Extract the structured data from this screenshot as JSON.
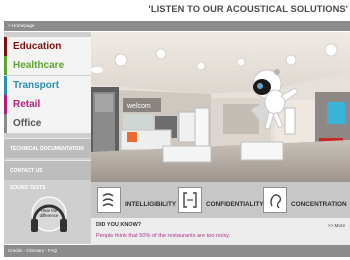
{
  "header": {
    "slogan": "'LISTEN TO OUR ACOUSTICAL SOLUTIONS'",
    "breadcrumb": "> Homepage"
  },
  "sidebar": {
    "nav_items": [
      {
        "label": "Education",
        "color": "#7a1111"
      },
      {
        "label": "Healthcare",
        "color": "#5ea531"
      },
      {
        "label": "Transport",
        "color": "#2a8fb6"
      },
      {
        "label": "Retail",
        "color": "#b41d7c"
      },
      {
        "label": "Office",
        "color": "#565656"
      }
    ],
    "technical_documentation": "TECHNICAL DOCUMENTATION",
    "contact_us": "CONTACT US",
    "sound_tests": "SOUND TESTS",
    "hear_difference": [
      "Hear the",
      "difference"
    ]
  },
  "hero": {
    "store_sign": "welcom"
  },
  "features": [
    {
      "label": "INTELLIGIBILITY",
      "icon": "sound-waves-icon"
    },
    {
      "label": "CONFIDENTIALITY",
      "icon": "privacy-bracket-icon"
    },
    {
      "label": "CONCENTRATION",
      "icon": "ear-icon"
    }
  ],
  "did_you_know": {
    "title": "DID YOU KNOW?",
    "more": ">> More",
    "fact": "People think that 50% of the restaurants are too noisy."
  },
  "footer": {
    "links": "Credits - Glossary - FAQ"
  }
}
